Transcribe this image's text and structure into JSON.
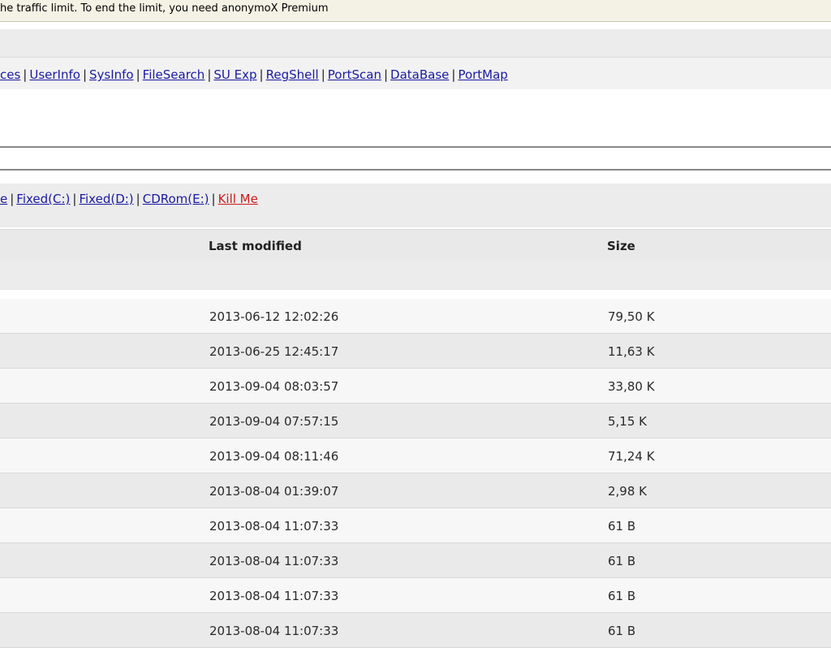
{
  "notice": {
    "text": "he traffic limit. To end the limit, you need anonymoX Premium"
  },
  "nav": {
    "links": [
      "ces",
      "UserInfo",
      "SysInfo",
      "FileSearch",
      "SU Exp",
      "RegShell",
      "PortScan",
      "DataBase",
      "PortMap"
    ],
    "separator": "|"
  },
  "drives": {
    "links": [
      "e",
      "Fixed(C:)",
      "Fixed(D:)",
      "CDRom(E:)"
    ],
    "kill_label": "Kill Me",
    "separator": "|"
  },
  "table": {
    "headers": {
      "last_modified": "Last modified",
      "size": "Size"
    },
    "rows": [
      {
        "modified": "2013-06-12 12:02:26",
        "size": "79,50 K"
      },
      {
        "modified": "2013-06-25 12:45:17",
        "size": "11,63 K"
      },
      {
        "modified": "2013-09-04 08:03:57",
        "size": "33,80 K"
      },
      {
        "modified": "2013-09-04 07:57:15",
        "size": "5,15 K"
      },
      {
        "modified": "2013-09-04 08:11:46",
        "size": "71,24 K"
      },
      {
        "modified": "2013-08-04 01:39:07",
        "size": "2,98 K"
      },
      {
        "modified": "2013-08-04 11:07:33",
        "size": "61 B"
      },
      {
        "modified": "2013-08-04 11:07:33",
        "size": "61 B"
      },
      {
        "modified": "2013-08-04 11:07:33",
        "size": "61 B"
      },
      {
        "modified": "2013-08-04 11:07:33",
        "size": "61 B"
      }
    ]
  },
  "colors": {
    "link": "#1a1aa0",
    "danger": "#cc1b1b",
    "notice_bg": "#f4f2e4"
  }
}
